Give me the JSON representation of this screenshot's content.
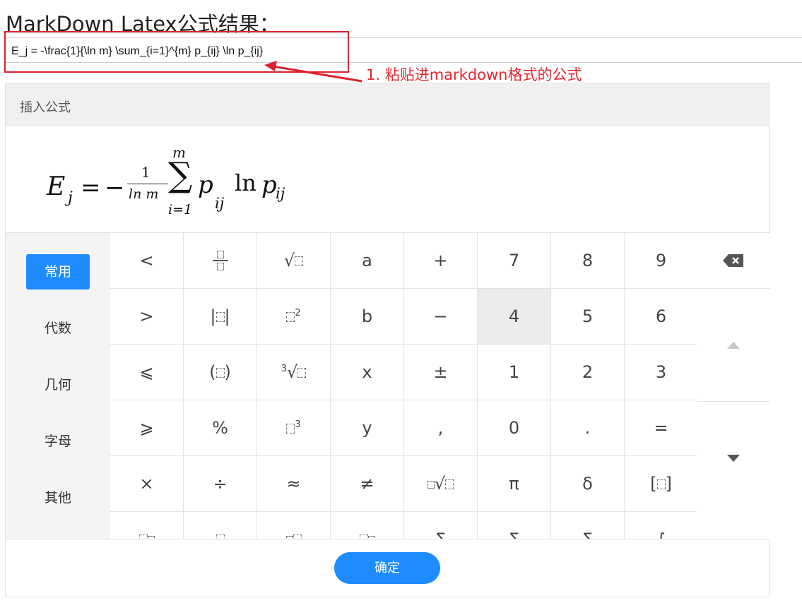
{
  "page": {
    "title": "MarkDown Latex公式结果："
  },
  "latex_input": {
    "value": "E_j = -\\frac{1}{\\ln m} \\sum_{i=1}^{m} p_{ij} \\ln p_{ij}"
  },
  "annotation": {
    "text": "1. 粘贴进markdown格式的公式",
    "color": "#e8262e"
  },
  "dialog": {
    "title": "插入公式",
    "formula": {
      "E": "E",
      "j": "j",
      "eq": "=",
      "minus": "−",
      "frac_num": "1",
      "frac_den": "ln m",
      "sum": "∑",
      "sum_top": "m",
      "sum_bottom": "i=1",
      "p1": "p",
      "ij1": "ij",
      "ln": "ln",
      "p2": "p",
      "ij2": "ij"
    },
    "categories": [
      {
        "label": "常用",
        "active": true
      },
      {
        "label": "代数",
        "active": false
      },
      {
        "label": "几何",
        "active": false
      },
      {
        "label": "字母",
        "active": false
      },
      {
        "label": "其他",
        "active": false
      }
    ],
    "keys": {
      "r0": [
        "<",
        "",
        "",
        "a",
        "+",
        "7",
        "8",
        "9"
      ],
      "r1": [
        ">",
        "",
        "",
        "b",
        "−",
        "4",
        "5",
        "6"
      ],
      "r2": [
        "⩽",
        "",
        "",
        "x",
        "±",
        "1",
        "2",
        "3"
      ],
      "r3": [
        "⩾",
        "%",
        "",
        "y",
        ",",
        "0",
        ".",
        "="
      ],
      "r4": [
        "×",
        "÷",
        "≈",
        "≠",
        "",
        "π",
        "δ",
        ""
      ],
      "r5": [
        "",
        "",
        "",
        "",
        "Σ",
        "Σ",
        "Σ",
        "∫"
      ]
    },
    "templates": {
      "frac": "fraction-template",
      "abs": "absolute-value-template",
      "sqrt": "square-root-template",
      "square": "square-template",
      "paren": "parentheses-template",
      "cbrt": "cube-root-template",
      "cube": "cube-template",
      "nroot": "nth-root-template",
      "bracket": "brackets-template",
      "sup2": "2",
      "sup3": "3",
      "cbrt_index": "3"
    },
    "confirm_label": "确定",
    "accent_color": "#1e8cff"
  }
}
